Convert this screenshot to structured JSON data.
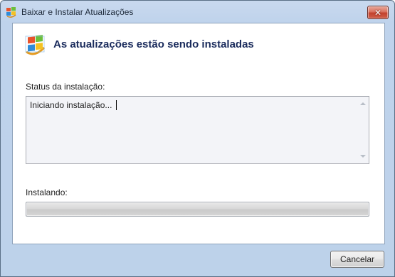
{
  "window": {
    "title": "Baixar e Instalar Atualizações",
    "app_icon": "windows-update-icon",
    "close_icon": "close-icon",
    "close_glyph": "✕"
  },
  "header": {
    "icon": "windows-update-icon",
    "heading": "As atualizações estão sendo instaladas"
  },
  "status": {
    "label": "Status da instalação:",
    "text": "Iniciando instalação..."
  },
  "progress": {
    "label": "Instalando:",
    "value_fraction": 0.0
  },
  "footer": {
    "cancel_label": "Cancelar"
  },
  "colors": {
    "heading": "#1a2b5c",
    "window_frame": "#bfd3ec",
    "close_button": "#c2412c"
  }
}
